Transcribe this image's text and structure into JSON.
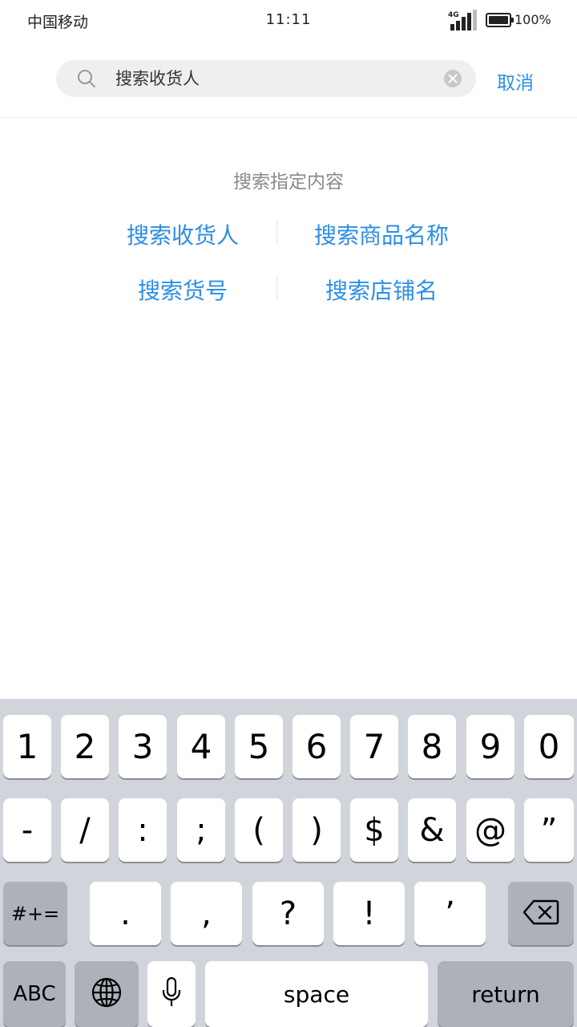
{
  "status_bar": {
    "carrier": "中国移动",
    "time": "11:11",
    "network": "4G",
    "battery_percent_text": "100%",
    "battery_level": 1.0
  },
  "search": {
    "placeholder": "搜索收货人",
    "cancel_label": "取消"
  },
  "options": {
    "title": "搜索指定内容",
    "items": [
      {
        "label": "搜索收货人"
      },
      {
        "label": "搜索商品名称"
      },
      {
        "label": "搜索货号"
      },
      {
        "label": "搜索店铺名"
      }
    ]
  },
  "keyboard": {
    "row1": [
      "1",
      "2",
      "3",
      "4",
      "5",
      "6",
      "7",
      "8",
      "9",
      "0"
    ],
    "row2": [
      "-",
      "/",
      ":",
      ";",
      "(",
      ")",
      "$",
      "&",
      "@",
      "”"
    ],
    "row3": {
      "symbols_label": "#+=",
      "keys": [
        ".",
        ",",
        "?",
        "!",
        "’"
      ],
      "delete_icon": "backspace-icon"
    },
    "row4": {
      "abc_label": "ABC",
      "globe_icon": "globe-icon",
      "mic_icon": "microphone-icon",
      "space_label": "space",
      "return_label": "return"
    }
  },
  "colors": {
    "accent": "#2d8ee6",
    "keyboard_bg": "#d1d5db",
    "key_dark": "#acb1ba"
  }
}
